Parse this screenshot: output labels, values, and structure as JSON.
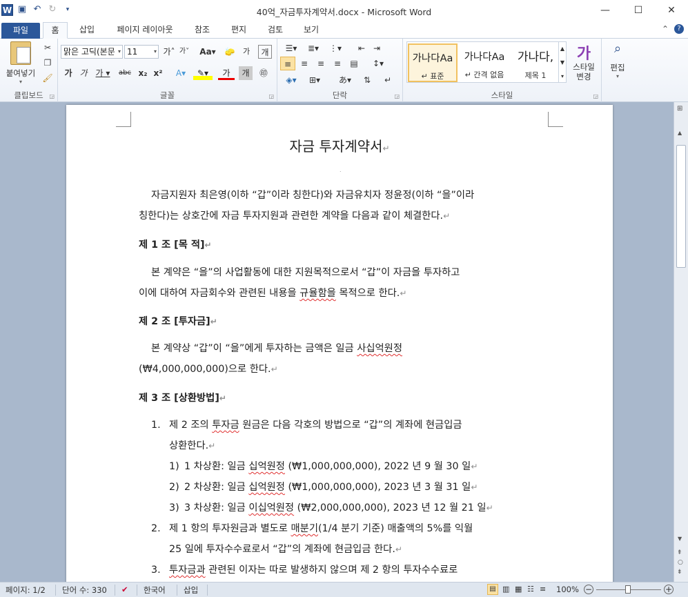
{
  "window": {
    "title": "40억_자금투자계약서.docx - Microsoft Word",
    "app_icon": "W"
  },
  "tabs": [
    "파일",
    "홈",
    "삽입",
    "페이지 레이아웃",
    "참조",
    "편지",
    "검토",
    "보기"
  ],
  "ribbon": {
    "clipboard": {
      "paste_label": "붙여넣기",
      "group_label": "클립보드"
    },
    "font": {
      "font_name": "맑은 고딕(본문",
      "font_size": "11",
      "group_label": "글꼴",
      "buttons_row1": [
        "가",
        "가",
        "Aa",
        "가",
        "개"
      ],
      "buttons_row2": [
        "가",
        "가",
        "가",
        "abc",
        "x₂",
        "x²"
      ]
    },
    "paragraph": {
      "group_label": "단락"
    },
    "styles": {
      "group_label": "스타일",
      "items": [
        {
          "preview": "가나다Aa",
          "name": "↵ 표준"
        },
        {
          "preview": "가나다Aa",
          "name": "↵ 간격 없음"
        },
        {
          "preview": "가나다,",
          "name": "제목 1"
        }
      ],
      "change_label": "스타일\n변경"
    },
    "editing": {
      "label": "편집"
    }
  },
  "document": {
    "title": "자금 투자계약서",
    "intro_1": "자금지원자 최은영(이하 “갑”이라 칭한다)와 자금유치자 정윤정(이하 “을”이라",
    "intro_2": "칭한다)는 상호간에 자금 투자지원과 관련한 계약을 다음과 같이 체결한다.",
    "art1_head": "제 1 조 [목 적]",
    "art1_1": "본 계약은 “을”의 사업활동에 대한 지원목적으로서 “갑”이 자금을 투자하고",
    "art1_2a": "이에 대하여 자금회수와 관련된 내용을 ",
    "art1_2w": "규율함을",
    "art1_2b": " 목적으로 한다.",
    "art2_head": "제 2 조 [투자금]",
    "art2_1a": "본 계약상 “갑”이 “을”에게 투자하는 금액은 일금 ",
    "art2_1w": "사십억원정",
    "art2_2": "(₩4,000,000,000)으로 한다.",
    "art3_head": "제 3 조 [상환방법]",
    "item1_num": "1.",
    "item1_1a": "제 2 조의 ",
    "item1_1w": "투자금",
    "item1_1b": " 원금은 다음 각호의 방법으로 “갑”의 계좌에 현금입금",
    "item1_2": "상환한다.",
    "sub1": {
      "num": "1)",
      "a": "1 차상환: 일금 ",
      "w": "십억원정",
      "b": " (₩1,000,000,000), 2022 년 9 월 30 일"
    },
    "sub2": {
      "num": "2)",
      "a": "2 차상환: 일금 ",
      "w": "십억원정",
      "b": " (₩1,000,000,000), 2023 년 3 월 31 일"
    },
    "sub3": {
      "num": "3)",
      "a": "3 차상환: 일금 ",
      "w": "이십억원정",
      "b": " (₩2,000,000,000), 2023 년 12 월 21 일"
    },
    "item2_num": "2.",
    "item2_1a": "제 1 항의 투자원금과 별도로 ",
    "item2_1w": "매분기",
    "item2_1b": "(1/4 분기 기준) 매출액의 5%를 익월",
    "item2_2": "25 일에 투자수수료로서 “갑”의 계좌에 현금입금 한다.",
    "item3_num": "3.",
    "item3_1w": "투자금과",
    "item3_1b": " 관련된 이자는 따로 발생하지 않으며 제 2 항의 투자수수료로"
  },
  "status": {
    "page": "페이지: 1/2",
    "words": "단어 수: 330",
    "language": "한국어",
    "mode": "삽입",
    "zoom": "100%"
  }
}
